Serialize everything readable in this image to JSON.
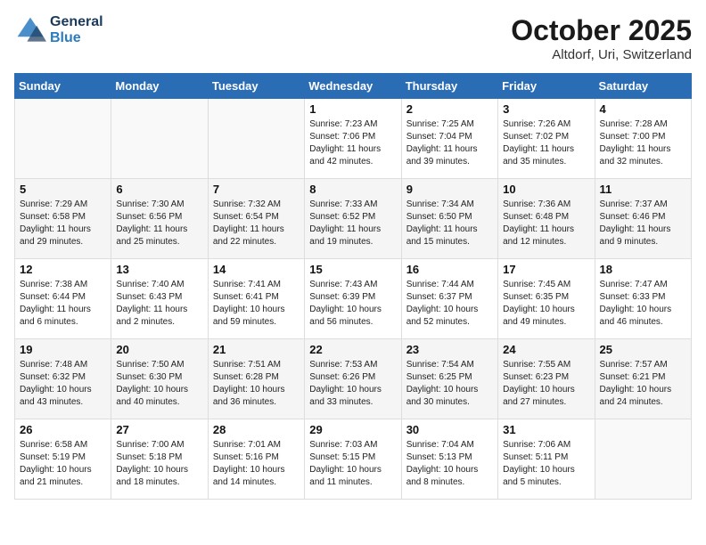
{
  "header": {
    "logo_line1": "General",
    "logo_line2": "Blue",
    "month": "October 2025",
    "location": "Altdorf, Uri, Switzerland"
  },
  "weekdays": [
    "Sunday",
    "Monday",
    "Tuesday",
    "Wednesday",
    "Thursday",
    "Friday",
    "Saturday"
  ],
  "weeks": [
    [
      {
        "day": "",
        "info": ""
      },
      {
        "day": "",
        "info": ""
      },
      {
        "day": "",
        "info": ""
      },
      {
        "day": "1",
        "info": "Sunrise: 7:23 AM\nSunset: 7:06 PM\nDaylight: 11 hours and 42 minutes."
      },
      {
        "day": "2",
        "info": "Sunrise: 7:25 AM\nSunset: 7:04 PM\nDaylight: 11 hours and 39 minutes."
      },
      {
        "day": "3",
        "info": "Sunrise: 7:26 AM\nSunset: 7:02 PM\nDaylight: 11 hours and 35 minutes."
      },
      {
        "day": "4",
        "info": "Sunrise: 7:28 AM\nSunset: 7:00 PM\nDaylight: 11 hours and 32 minutes."
      }
    ],
    [
      {
        "day": "5",
        "info": "Sunrise: 7:29 AM\nSunset: 6:58 PM\nDaylight: 11 hours and 29 minutes."
      },
      {
        "day": "6",
        "info": "Sunrise: 7:30 AM\nSunset: 6:56 PM\nDaylight: 11 hours and 25 minutes."
      },
      {
        "day": "7",
        "info": "Sunrise: 7:32 AM\nSunset: 6:54 PM\nDaylight: 11 hours and 22 minutes."
      },
      {
        "day": "8",
        "info": "Sunrise: 7:33 AM\nSunset: 6:52 PM\nDaylight: 11 hours and 19 minutes."
      },
      {
        "day": "9",
        "info": "Sunrise: 7:34 AM\nSunset: 6:50 PM\nDaylight: 11 hours and 15 minutes."
      },
      {
        "day": "10",
        "info": "Sunrise: 7:36 AM\nSunset: 6:48 PM\nDaylight: 11 hours and 12 minutes."
      },
      {
        "day": "11",
        "info": "Sunrise: 7:37 AM\nSunset: 6:46 PM\nDaylight: 11 hours and 9 minutes."
      }
    ],
    [
      {
        "day": "12",
        "info": "Sunrise: 7:38 AM\nSunset: 6:44 PM\nDaylight: 11 hours and 6 minutes."
      },
      {
        "day": "13",
        "info": "Sunrise: 7:40 AM\nSunset: 6:43 PM\nDaylight: 11 hours and 2 minutes."
      },
      {
        "day": "14",
        "info": "Sunrise: 7:41 AM\nSunset: 6:41 PM\nDaylight: 10 hours and 59 minutes."
      },
      {
        "day": "15",
        "info": "Sunrise: 7:43 AM\nSunset: 6:39 PM\nDaylight: 10 hours and 56 minutes."
      },
      {
        "day": "16",
        "info": "Sunrise: 7:44 AM\nSunset: 6:37 PM\nDaylight: 10 hours and 52 minutes."
      },
      {
        "day": "17",
        "info": "Sunrise: 7:45 AM\nSunset: 6:35 PM\nDaylight: 10 hours and 49 minutes."
      },
      {
        "day": "18",
        "info": "Sunrise: 7:47 AM\nSunset: 6:33 PM\nDaylight: 10 hours and 46 minutes."
      }
    ],
    [
      {
        "day": "19",
        "info": "Sunrise: 7:48 AM\nSunset: 6:32 PM\nDaylight: 10 hours and 43 minutes."
      },
      {
        "day": "20",
        "info": "Sunrise: 7:50 AM\nSunset: 6:30 PM\nDaylight: 10 hours and 40 minutes."
      },
      {
        "day": "21",
        "info": "Sunrise: 7:51 AM\nSunset: 6:28 PM\nDaylight: 10 hours and 36 minutes."
      },
      {
        "day": "22",
        "info": "Sunrise: 7:53 AM\nSunset: 6:26 PM\nDaylight: 10 hours and 33 minutes."
      },
      {
        "day": "23",
        "info": "Sunrise: 7:54 AM\nSunset: 6:25 PM\nDaylight: 10 hours and 30 minutes."
      },
      {
        "day": "24",
        "info": "Sunrise: 7:55 AM\nSunset: 6:23 PM\nDaylight: 10 hours and 27 minutes."
      },
      {
        "day": "25",
        "info": "Sunrise: 7:57 AM\nSunset: 6:21 PM\nDaylight: 10 hours and 24 minutes."
      }
    ],
    [
      {
        "day": "26",
        "info": "Sunrise: 6:58 AM\nSunset: 5:19 PM\nDaylight: 10 hours and 21 minutes."
      },
      {
        "day": "27",
        "info": "Sunrise: 7:00 AM\nSunset: 5:18 PM\nDaylight: 10 hours and 18 minutes."
      },
      {
        "day": "28",
        "info": "Sunrise: 7:01 AM\nSunset: 5:16 PM\nDaylight: 10 hours and 14 minutes."
      },
      {
        "day": "29",
        "info": "Sunrise: 7:03 AM\nSunset: 5:15 PM\nDaylight: 10 hours and 11 minutes."
      },
      {
        "day": "30",
        "info": "Sunrise: 7:04 AM\nSunset: 5:13 PM\nDaylight: 10 hours and 8 minutes."
      },
      {
        "day": "31",
        "info": "Sunrise: 7:06 AM\nSunset: 5:11 PM\nDaylight: 10 hours and 5 minutes."
      },
      {
        "day": "",
        "info": ""
      }
    ]
  ]
}
